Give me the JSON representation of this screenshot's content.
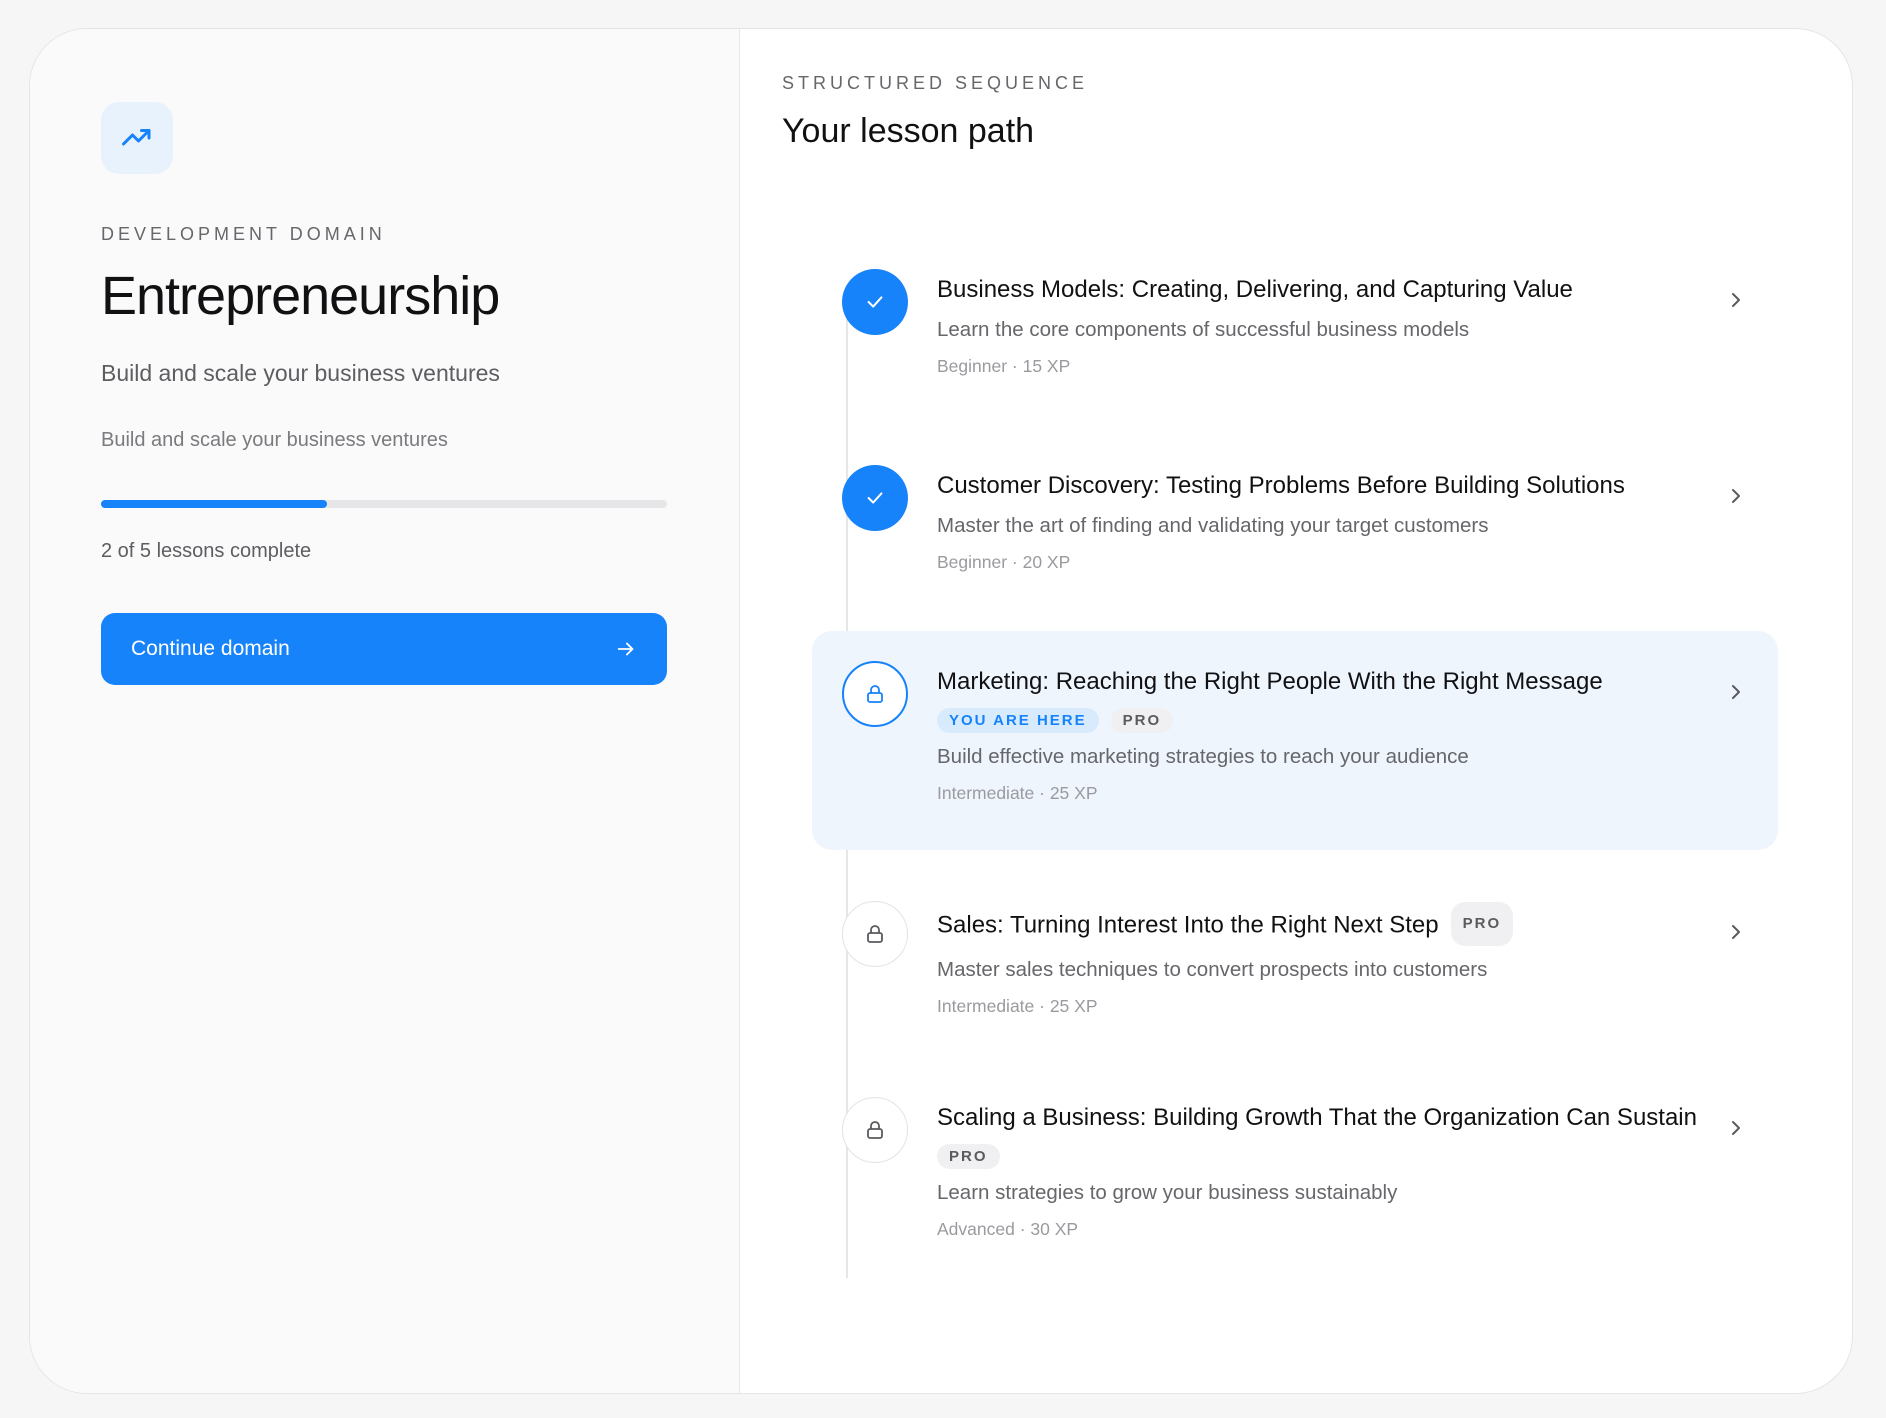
{
  "colors": {
    "accent": "#1683fb",
    "accent_soft": "#e8f2fd",
    "current_bg": "#eef5fd"
  },
  "domain": {
    "icon": "trending-up-icon",
    "eyebrow": "DEVELOPMENT DOMAIN",
    "title": "Entrepreneurship",
    "subtitle": "Build and scale your business ventures",
    "description": "Build and scale your business ventures",
    "progress_fraction": 0.4,
    "progress_text": "2 of 5 lessons complete",
    "continue_label": "Continue domain"
  },
  "path": {
    "eyebrow": "STRUCTURED SEQUENCE",
    "title": "Your lesson path",
    "lessons": [
      {
        "title": "Business Models: Creating, Delivering, and Capturing Value",
        "description": "Learn the core components of successful business models",
        "meta": "Beginner · 15 XP",
        "status": "completed"
      },
      {
        "title": "Customer Discovery: Testing Problems Before Building Solutions",
        "description": "Master the art of finding and validating your target customers",
        "meta": "Beginner · 20 XP",
        "status": "completed"
      },
      {
        "title": "Marketing: Reaching the Right People With the Right Message",
        "here_badge": "YOU ARE HERE",
        "pro_badge": "PRO",
        "description": "Build effective marketing strategies to reach your audience",
        "meta": "Intermediate · 25 XP",
        "status": "current"
      },
      {
        "title": "Sales: Turning Interest Into the Right Next Step",
        "pro_badge": "PRO",
        "description": "Master sales techniques to convert prospects into customers",
        "meta": "Intermediate · 25 XP",
        "status": "locked"
      },
      {
        "title": "Scaling a Business: Building Growth That the Organization Can Sustain",
        "pro_badge": "PRO",
        "description": "Learn strategies to grow your business sustainably",
        "meta": "Advanced · 30 XP",
        "status": "locked"
      }
    ]
  }
}
